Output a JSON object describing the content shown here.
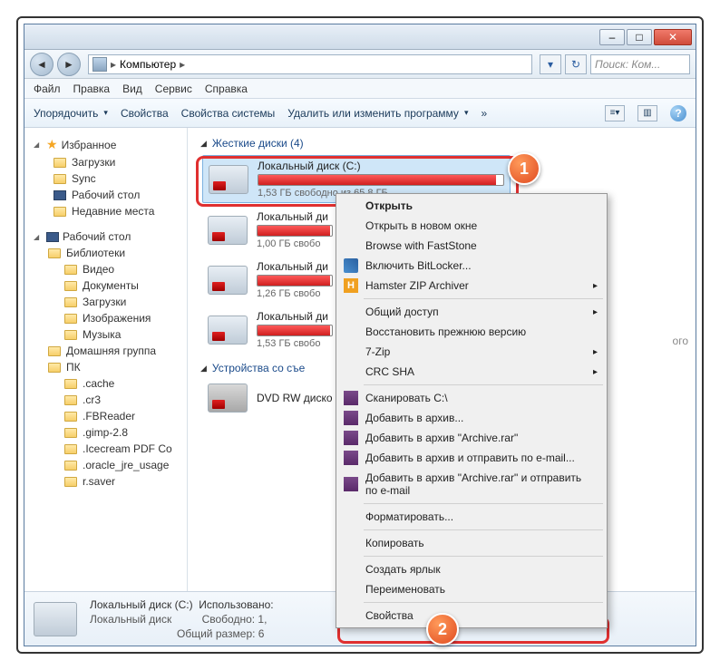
{
  "window": {
    "title": "Компьютер"
  },
  "address": {
    "location": "Компьютер",
    "sep": "▸"
  },
  "search": {
    "placeholder": "Поиск: Ком..."
  },
  "menubar": {
    "file": "Файл",
    "edit": "Правка",
    "view": "Вид",
    "service": "Сервис",
    "help": "Справка"
  },
  "toolbar": {
    "organize": "Упорядочить",
    "properties": "Свойства",
    "system_properties": "Свойства системы",
    "uninstall": "Удалить или изменить программу",
    "more": "»"
  },
  "sidebar": {
    "favorites": "Избранное",
    "fav_items": [
      "Загрузки",
      "Sync",
      "Рабочий стол",
      "Недавние места"
    ],
    "desktop": "Рабочий стол",
    "libraries": "Библиотеки",
    "lib_items": [
      "Видео",
      "Документы",
      "Загрузки",
      "Изображения",
      "Музыка"
    ],
    "homegroup": "Домашняя группа",
    "pc": "ПК",
    "pc_items": [
      ".cache",
      ".cr3",
      ".FBReader",
      ".gimp-2.8",
      ".Icecream PDF Co",
      ".oracle_jre_usage",
      "r.saver"
    ]
  },
  "sections": {
    "hard_drives": "Жесткие диски (4)",
    "removable": "Устройства со съе"
  },
  "drives": [
    {
      "name": "Локальный диск (C:)",
      "free": "1,53 ГБ свободно из 65,8 ГБ",
      "fill": 97
    },
    {
      "name": "Локальный ди",
      "free": "1,00 ГБ свобо",
      "fill": 98
    },
    {
      "name": "Локальный ди",
      "free": "1,26 ГБ свобо",
      "fill": 97
    },
    {
      "name": "Локальный ди",
      "free": "1,53 ГБ свобо",
      "fill": 97
    }
  ],
  "dvd": {
    "name": "DVD RW диско"
  },
  "context_menu": {
    "open": "Открыть",
    "open_new": "Открыть в новом окне",
    "faststone": "Browse with FastStone",
    "bitlocker": "Включить BitLocker...",
    "hamster": "Hamster ZIP Archiver",
    "share": "Общий доступ",
    "restore": "Восстановить прежнюю версию",
    "sevenzip": "7-Zip",
    "crcsha": "CRC SHA",
    "scan": "Сканировать C:\\",
    "add_archive": "Добавить в архив...",
    "add_archive_rar": "Добавить в архив \"Archive.rar\"",
    "add_send": "Добавить в архив и отправить по e-mail...",
    "add_rar_send": "Добавить в архив \"Archive.rar\" и отправить по e-mail",
    "format": "Форматировать...",
    "copy": "Копировать",
    "shortcut": "Создать ярлык",
    "rename": "Переименовать",
    "properties": "Свойства"
  },
  "status": {
    "name": "Локальный диск (C:)",
    "type": "Локальный диск",
    "used_label": "Использовано:",
    "free_label": "Свободно: 1,",
    "total_label": "Общий размер: 6"
  },
  "overlay_text": "ого",
  "callouts": {
    "one": "1",
    "two": "2"
  }
}
